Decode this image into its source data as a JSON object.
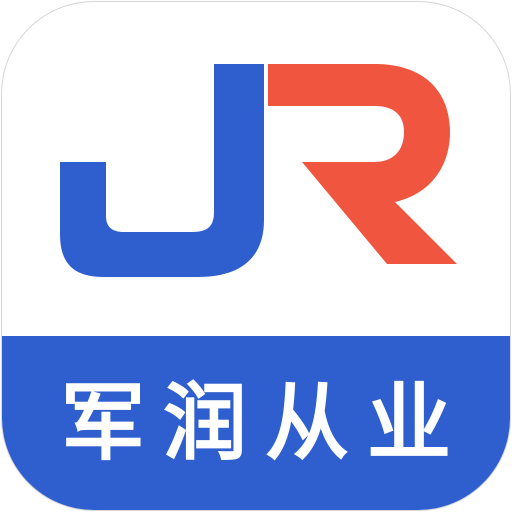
{
  "app_icon": {
    "logo_letters": "JR",
    "name": "军润从业",
    "colors": {
      "blue": "#2f5fcf",
      "red": "#f05540",
      "background": "#ffffff",
      "banner_text": "#ffffff"
    }
  }
}
